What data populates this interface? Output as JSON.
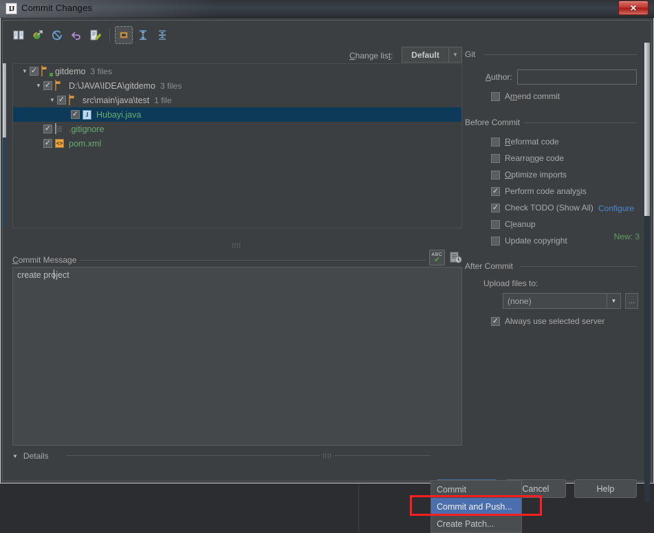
{
  "window": {
    "title": "Commit Changes",
    "app_icon": "intellij-idea-icon",
    "close_label": "✕"
  },
  "toolbar": {
    "items": [
      {
        "name": "show-diff-icon",
        "label": "Show Diff"
      },
      {
        "name": "revert-selected-icon",
        "label": "Revert"
      },
      {
        "name": "refresh-icon",
        "label": "Refresh Changes"
      },
      {
        "name": "rollback-icon",
        "label": "Rollback"
      },
      {
        "name": "move-to-changelist-icon",
        "label": "Move to Another Changelist"
      },
      {
        "name": "group-by-directory-icon",
        "label": "Group by Directory"
      },
      {
        "name": "expand-all-icon",
        "label": "Expand All"
      },
      {
        "name": "collapse-all-icon",
        "label": "Collapse All"
      }
    ]
  },
  "changelist": {
    "label": "Change list:",
    "value": "Default",
    "arrow": "▼"
  },
  "tree": {
    "rows": [
      {
        "indent": 0,
        "twisty": "▼",
        "checked": true,
        "icon": "folder-module-icon",
        "name": "gitdemo",
        "count": "3 files",
        "selected": false,
        "green": false
      },
      {
        "indent": 1,
        "twisty": "▼",
        "checked": true,
        "icon": "folder-icon",
        "name": "D:\\JAVA\\IDEA\\gitdemo",
        "count": "3 files",
        "selected": false,
        "green": false
      },
      {
        "indent": 2,
        "twisty": "▼",
        "checked": true,
        "icon": "folder-icon",
        "name": "src\\main\\java\\test",
        "count": "1 file",
        "selected": false,
        "green": false
      },
      {
        "indent": 3,
        "twisty": "",
        "checked": true,
        "icon": "java-file-icon",
        "name": "Hubayi.java",
        "count": "",
        "selected": true,
        "green": true
      },
      {
        "indent": 1,
        "twisty": "",
        "checked": true,
        "icon": "text-file-icon",
        "name": ".gitignore",
        "count": "",
        "selected": false,
        "green": true
      },
      {
        "indent": 1,
        "twisty": "",
        "checked": true,
        "icon": "xml-file-icon",
        "name": "pom.xml",
        "count": "",
        "selected": false,
        "green": true
      }
    ],
    "new_count": "New: 3",
    "splitter_dots": "⁞⁞⁞⁞"
  },
  "commit_message": {
    "label": "Commit Message",
    "value": "create project",
    "spellcheck_icon": "spellcheck-icon",
    "spellcheck_abc": "ABC",
    "spellcheck_tick": "✔",
    "history_icon": "message-history-icon"
  },
  "details": {
    "twisty": "▼",
    "label": "Details",
    "dots": "⁞⁞⁞⁞"
  },
  "git_section": {
    "title": "Git",
    "author_label": "Author:",
    "author_value": "",
    "amend": {
      "label": "Amend commit",
      "checked": false,
      "mnemonic_index": 1
    }
  },
  "before_commit": {
    "title": "Before Commit",
    "options": [
      {
        "label": "Reformat code",
        "checked": false
      },
      {
        "label": "Rearrange code",
        "checked": false
      },
      {
        "label": "Optimize imports",
        "checked": false
      },
      {
        "label": "Perform code analysis",
        "checked": true
      },
      {
        "label": "Check TODO (Show All)",
        "checked": true
      },
      {
        "label": "Cleanup",
        "checked": false
      },
      {
        "label": "Update copyright",
        "checked": false
      }
    ],
    "configure_link": "Configure"
  },
  "after_commit": {
    "title": "After Commit",
    "upload_label": "Upload files to:",
    "upload_value": "(none)",
    "upload_arrow": "▼",
    "upload_ellipsis": "...",
    "always_use": {
      "label": "Always use selected server",
      "checked": true
    }
  },
  "buttons": {
    "commit": "Commit",
    "commit_arrow": "▾",
    "cancel": "Cancel",
    "help": "Help"
  },
  "popup_menu": {
    "items": [
      {
        "label": "Commit",
        "highlighted": false
      },
      {
        "label": "Commit and Push...",
        "highlighted": true
      },
      {
        "label": "Create Patch...",
        "highlighted": false
      }
    ],
    "annotation_color": "#ff1f1f"
  },
  "colors": {
    "panel_bg": "#3c3f41",
    "selection_blue": "#0d3a58",
    "menu_highlight": "#4b6eaf",
    "link_blue": "#4b87d4",
    "added_green": "#6aab73",
    "new_count_green": "#5f9e62",
    "commit_btn_bg": "#2e4a6b",
    "close_btn_red": "#c4423c"
  }
}
